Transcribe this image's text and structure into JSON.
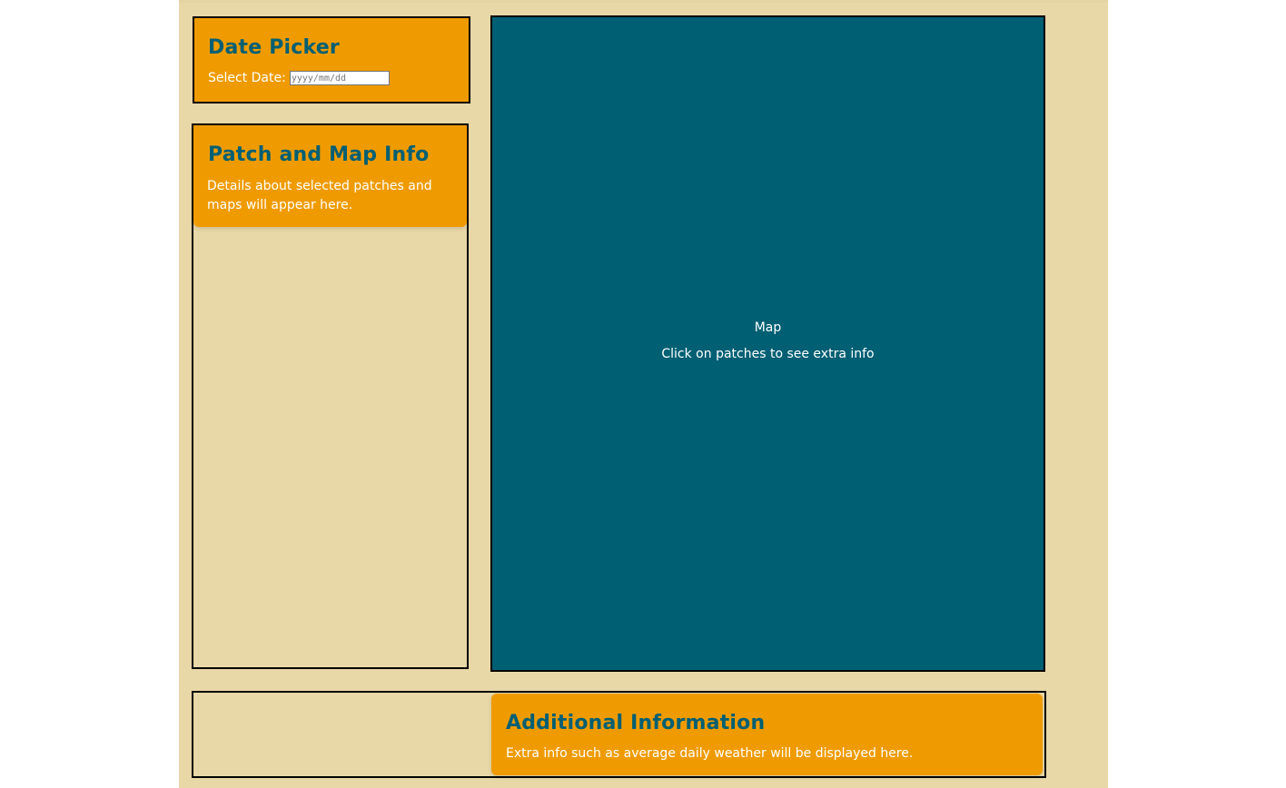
{
  "date_picker": {
    "title": "Date Picker",
    "label": "Select Date:",
    "input_placeholder": "yyyy/mm/dd",
    "input_value": ""
  },
  "patch_info": {
    "title": "Patch and Map Info",
    "text": "Details about selected patches and maps will appear here."
  },
  "map": {
    "title": "Map",
    "subtitle": "Click on patches to see extra info"
  },
  "additional_info": {
    "title": "Additional Information",
    "text": "Extra info such as average daily weather will be displayed here."
  },
  "colors": {
    "page_background": "#e8d7a7",
    "card_background": "#ef9b00",
    "heading": "#005f73",
    "map_background": "#005f73",
    "text_light": "#ffffff"
  }
}
